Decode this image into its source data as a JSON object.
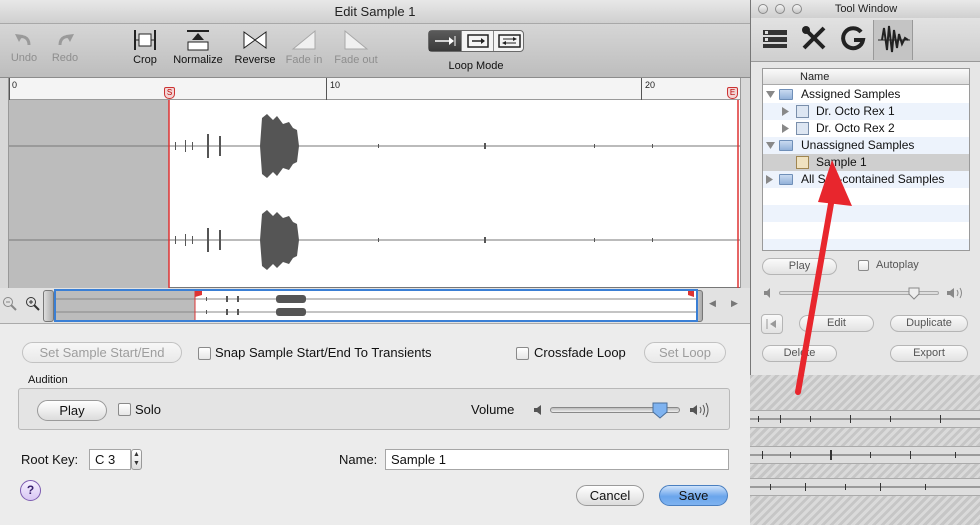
{
  "edit_window": {
    "title": "Edit Sample 1",
    "toolbar": {
      "undo": "Undo",
      "redo": "Redo",
      "crop": "Crop",
      "normalize": "Normalize",
      "reverse": "Reverse",
      "fade_in": "Fade in",
      "fade_out": "Fade out",
      "loop_mode": "Loop Mode"
    },
    "ruler": {
      "tick_0": "0",
      "tick_10": "10",
      "tick_20": "20",
      "start_marker": "S",
      "end_marker": "E"
    },
    "buttons": {
      "set_sample_start_end": "Set Sample Start/End",
      "set_loop": "Set Loop",
      "play": "Play",
      "cancel": "Cancel",
      "save": "Save",
      "help": "?"
    },
    "checkboxes": {
      "snap": "Snap Sample Start/End To Transients",
      "crossfade_loop": "Crossfade Loop",
      "solo": "Solo"
    },
    "audition_label": "Audition",
    "volume_label": "Volume",
    "volume_level": 0.9,
    "root_key_label": "Root Key:",
    "root_key_value": "C 3",
    "name_label": "Name:",
    "name_value": "Sample 1"
  },
  "tool_window": {
    "title": "Tool Window",
    "column_header": "Name",
    "items": [
      {
        "label": "Assigned Samples"
      },
      {
        "label": "Dr. Octo Rex 1"
      },
      {
        "label": "Dr. Octo Rex 2"
      },
      {
        "label": "Unassigned Samples"
      },
      {
        "label": "Sample 1"
      },
      {
        "label": "All Self-contained Samples"
      }
    ],
    "play": "Play",
    "autoplay": "Autoplay",
    "edit": "Edit",
    "duplicate": "Duplicate",
    "delete": "Delete",
    "export": "Export",
    "volume_level": 0.88
  },
  "colors": {
    "arrow": "#e8262d",
    "accent": "#3a7fd5",
    "marker": "#cc3333"
  }
}
